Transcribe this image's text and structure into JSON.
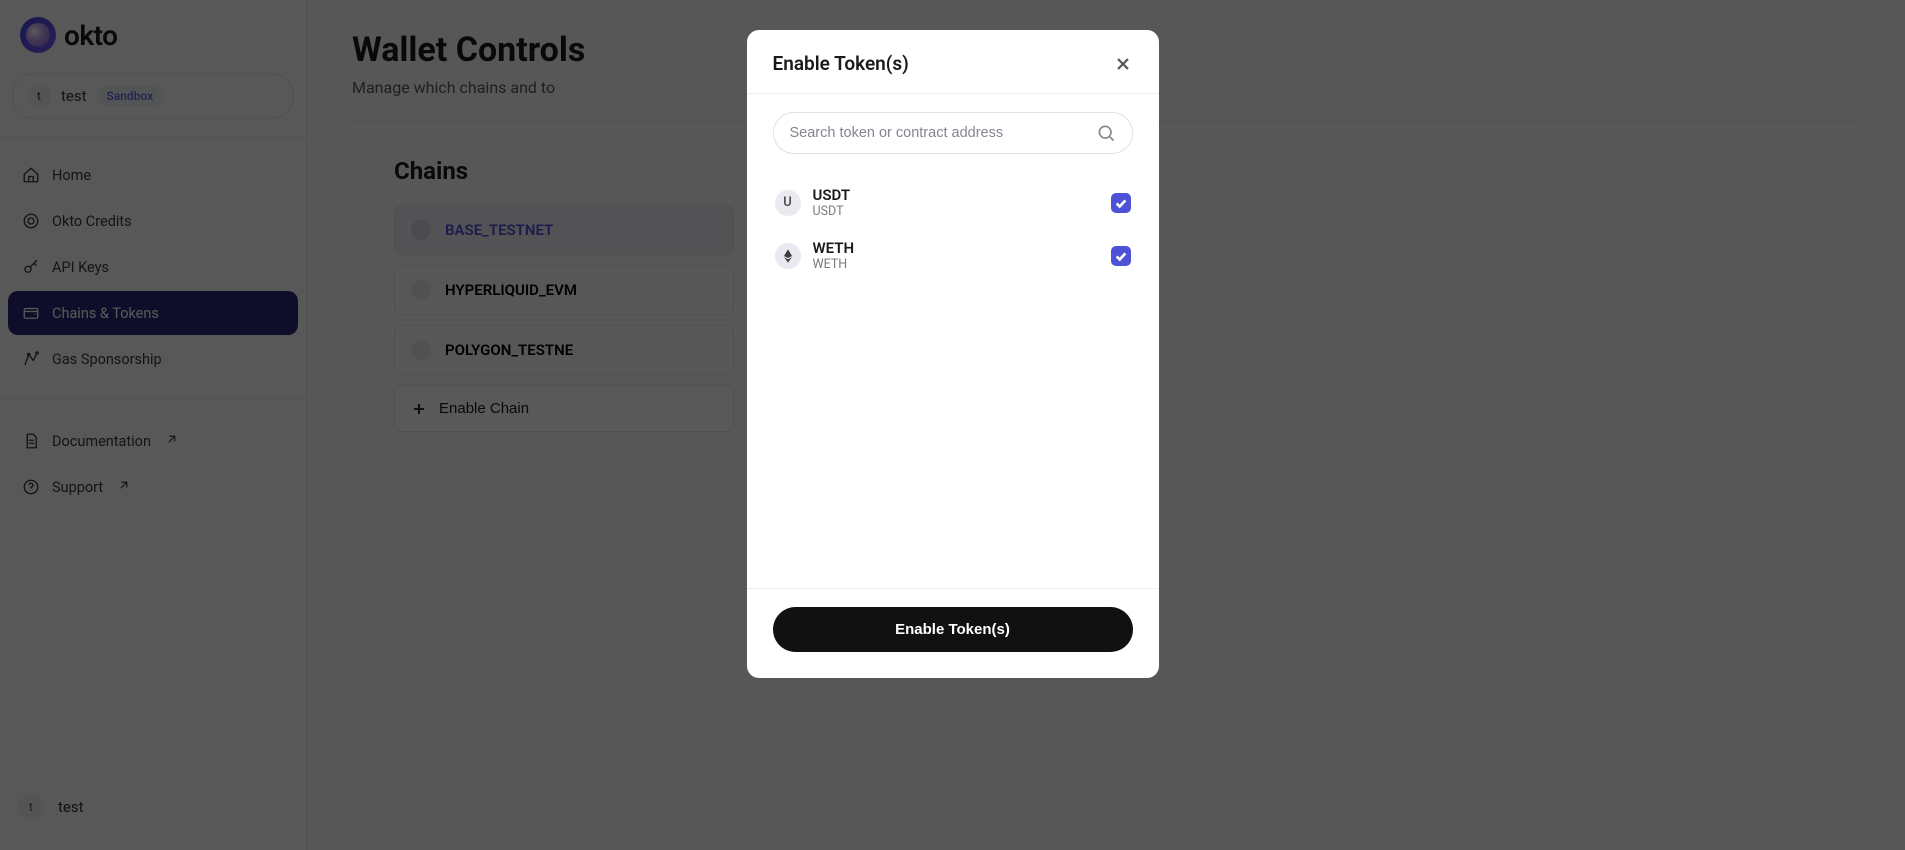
{
  "brand": "okto",
  "workspace": {
    "avatar_letter": "t",
    "name": "test",
    "badge": "Sandbox"
  },
  "sidebar": {
    "items": [
      {
        "label": "Home",
        "icon": "home",
        "active": false
      },
      {
        "label": "Okto Credits",
        "icon": "credits",
        "active": false
      },
      {
        "label": "API Keys",
        "icon": "key",
        "active": false
      },
      {
        "label": "Chains & Tokens",
        "icon": "wallet",
        "active": true
      },
      {
        "label": "Gas Sponsorship",
        "icon": "gas",
        "active": false
      }
    ],
    "secondary": [
      {
        "label": "Documentation",
        "icon": "doc",
        "external": true
      },
      {
        "label": "Support",
        "icon": "support",
        "external": true
      }
    ],
    "footer": {
      "avatar_letter": "t",
      "name": "test"
    }
  },
  "page": {
    "title": "Wallet Controls",
    "subtitle": "Manage which chains and to",
    "section_title": "Chains",
    "chains": [
      {
        "name": "BASE_TESTNET",
        "selected": true
      },
      {
        "name": "HYPERLIQUID_EVM",
        "selected": false
      },
      {
        "name": "POLYGON_TESTNE",
        "selected": false
      }
    ],
    "enable_chain_label": "Enable Chain"
  },
  "modal": {
    "title": "Enable Token(s)",
    "search_placeholder": "Search token or contract address",
    "tokens": [
      {
        "name": "USDT",
        "symbol": "USDT",
        "avatar_letter": "U",
        "avatar_type": "letter",
        "checked": true
      },
      {
        "name": "WETH",
        "symbol": "WETH",
        "avatar_type": "eth",
        "checked": true
      }
    ],
    "enable_button": "Enable Token(s)"
  }
}
